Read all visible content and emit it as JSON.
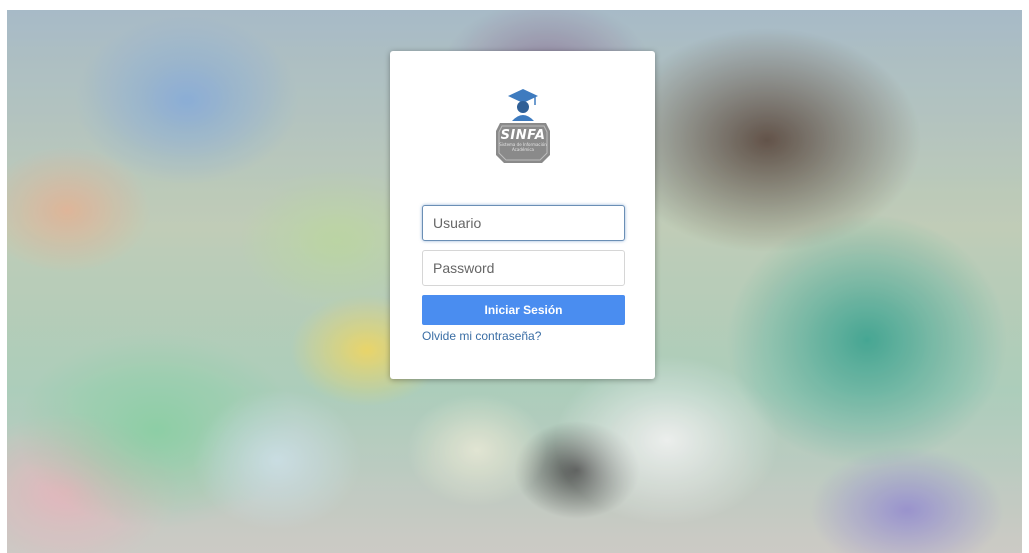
{
  "login": {
    "logo_text": "SINFA",
    "logo_caption": "Sistema de Información Académica",
    "username_placeholder": "Usuario",
    "password_placeholder": "Password",
    "submit_label": "Iniciar Sesión",
    "forgot_label": "Olvide mi contraseña?"
  },
  "colors": {
    "button": "#4a8df0",
    "link": "#3a6ea5",
    "logo_gray": "#8a8a8a",
    "logo_blue": "#3e7bbf"
  }
}
